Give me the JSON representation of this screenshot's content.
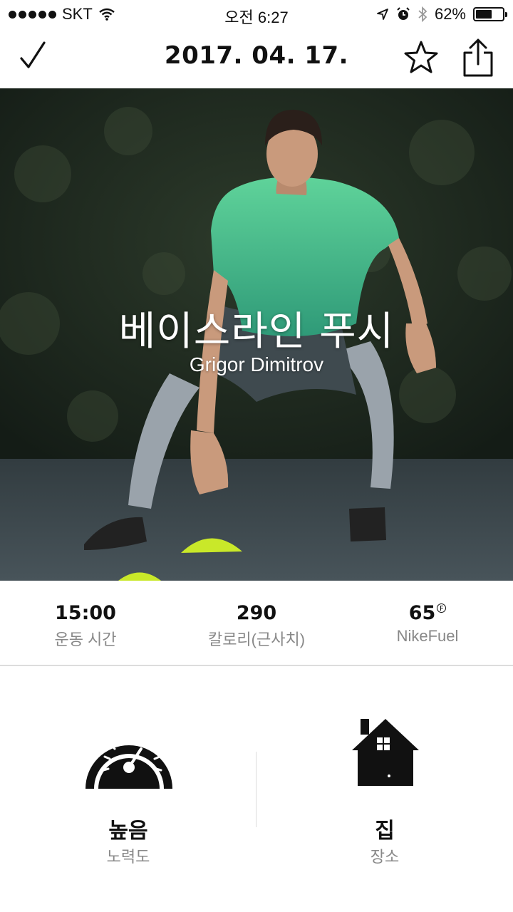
{
  "status_bar": {
    "carrier": "SKT",
    "time": "오전 6:27",
    "battery_percent": "62%",
    "battery_level": 0.62
  },
  "nav": {
    "title": "2017. 04. 17.",
    "icons": [
      "check-icon",
      "star-icon",
      "share-icon"
    ]
  },
  "hero": {
    "title": "베이스라인 푸시",
    "subtitle": "Grigor Dimitrov"
  },
  "stats": [
    {
      "value": "15:00",
      "label": "운동 시간"
    },
    {
      "value": "290",
      "label": "칼로리(근사치)"
    },
    {
      "value": "65",
      "label": "NikeFuel"
    }
  ],
  "details": {
    "intensity": {
      "value": "높음",
      "label": "노력도",
      "icon": "speedometer-icon"
    },
    "location": {
      "value": "집",
      "label": "장소",
      "icon": "house-icon"
    }
  }
}
